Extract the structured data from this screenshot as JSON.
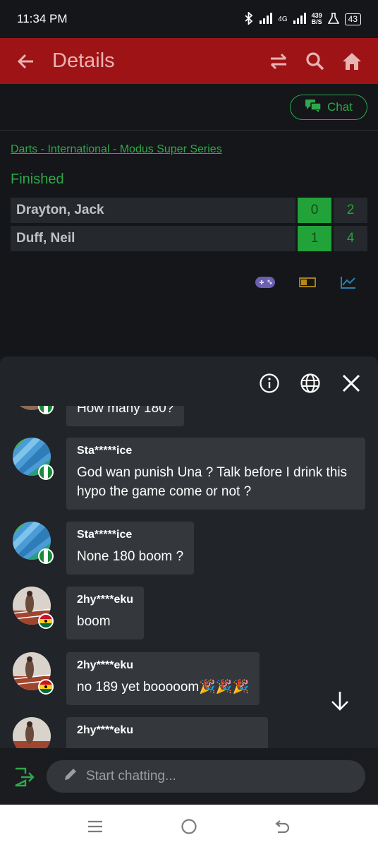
{
  "status_bar": {
    "time": "11:34 PM",
    "network": "4G",
    "speed": "439",
    "speed_unit": "B/S",
    "battery": "43"
  },
  "appbar": {
    "title": "Details"
  },
  "chat_button": {
    "label": "Chat"
  },
  "event": {
    "competition_link": "Darts - International - Modus Super Series",
    "status": "Finished",
    "rows": [
      {
        "name": "Drayton, Jack",
        "sets": "0",
        "legs": "2"
      },
      {
        "name": "Duff, Neil",
        "sets": "1",
        "legs": "4"
      }
    ]
  },
  "chat": {
    "messages": [
      {
        "user": "",
        "text": "How many 180?"
      },
      {
        "user": "Sta*****ice",
        "text": "God wan punish Una ? Talk before I drink this hypo the game come or not ?"
      },
      {
        "user": "Sta*****ice",
        "text": "None 180 boom ?"
      },
      {
        "user": "2hy****eku",
        "text": "boom"
      },
      {
        "user": "2hy****eku",
        "text": "no 189 yet booooom🎉🎉🎉"
      },
      {
        "user": "2hy****eku",
        "text": ""
      }
    ],
    "input_placeholder": "Start chatting..."
  },
  "colors": {
    "brand_red": "#9e1416",
    "accent_green": "#2ea84a",
    "bg": "#141619",
    "panel": "#212429",
    "bubble": "#34373c"
  }
}
